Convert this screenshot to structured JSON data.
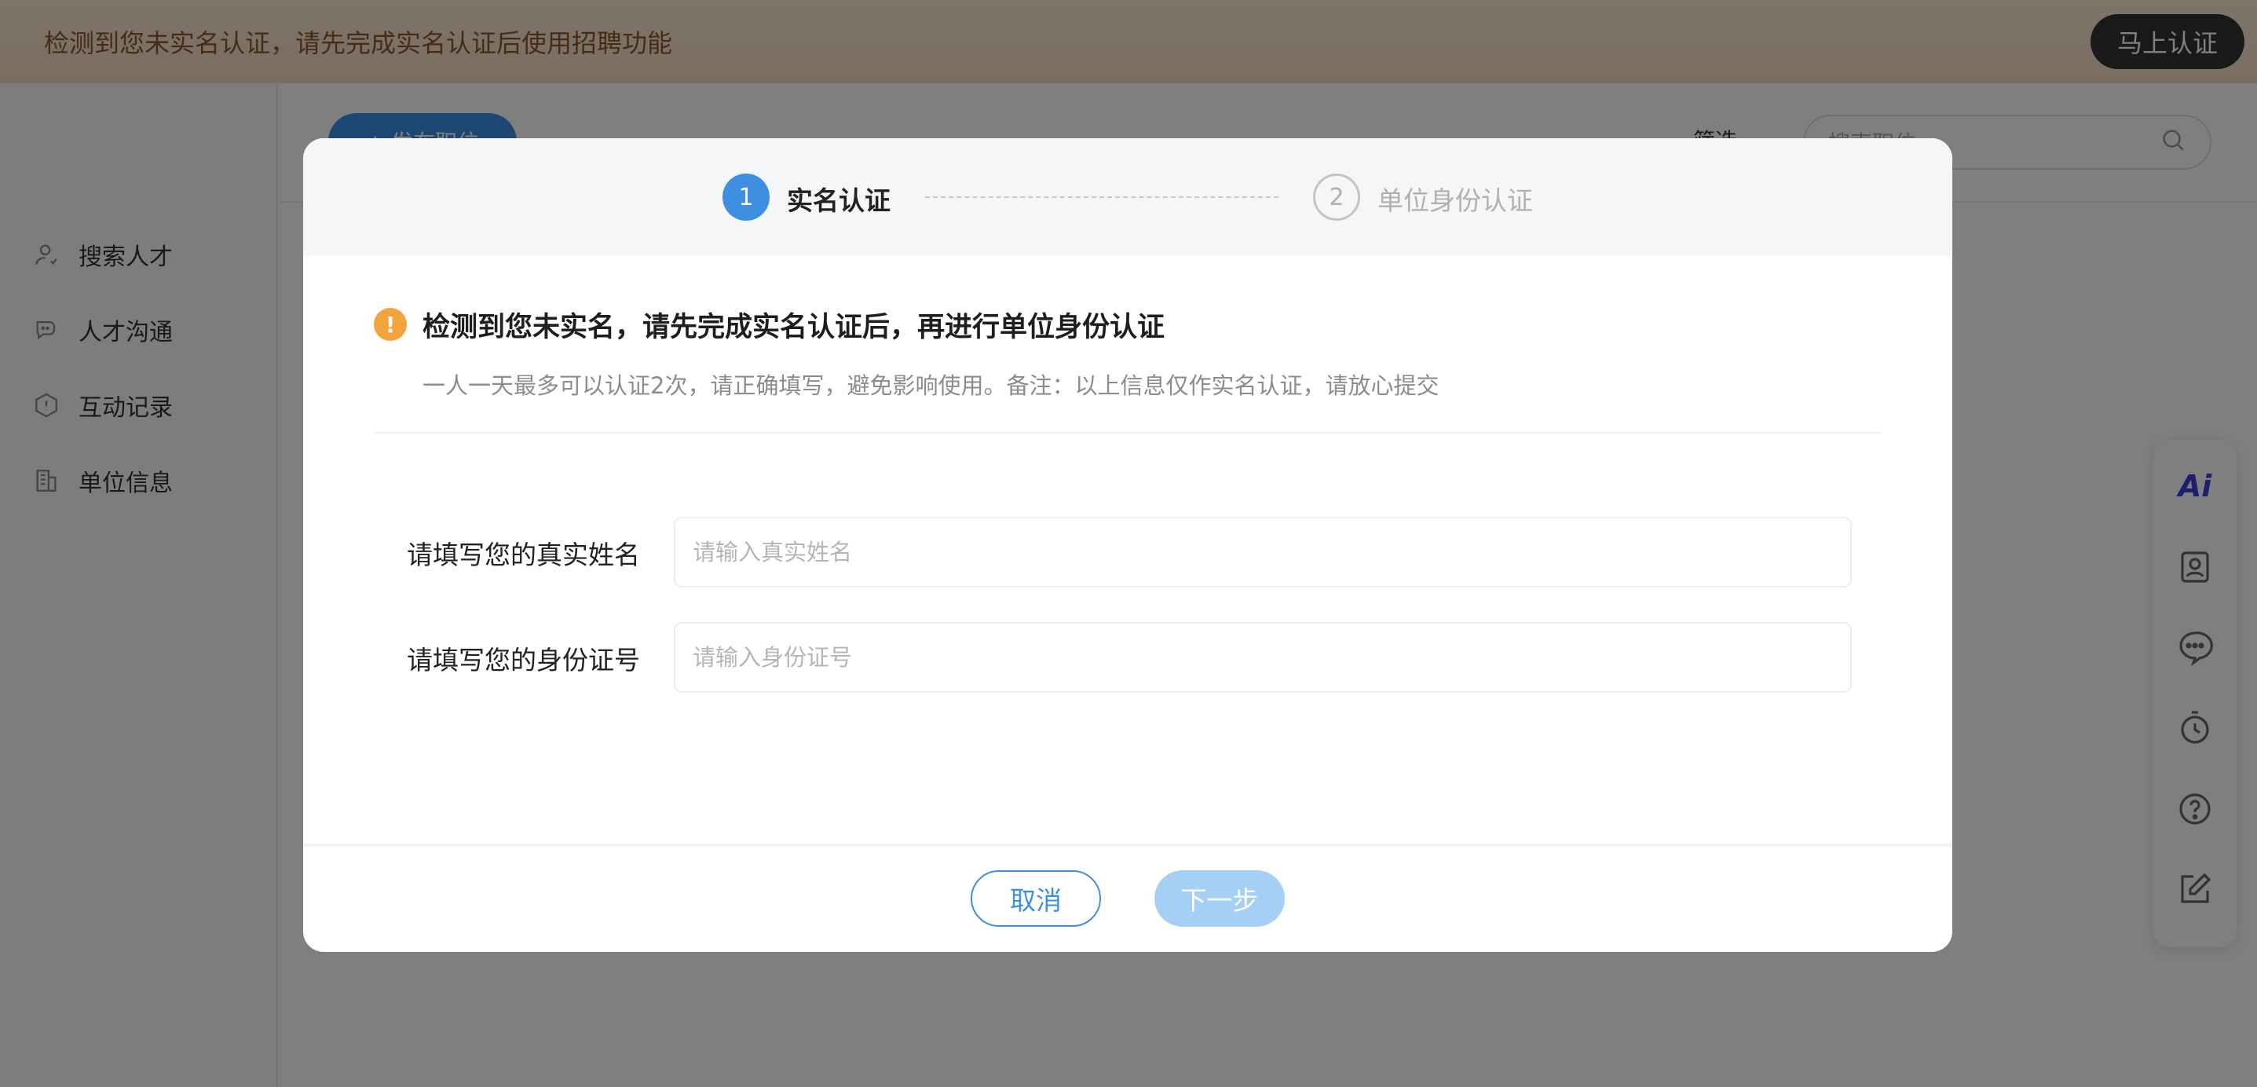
{
  "banner": {
    "text": "检测到您未实名认证，请先完成实名认证后使用招聘功能",
    "action_label": "马上认证"
  },
  "sidebar": {
    "items": [
      {
        "label": "搜索人才",
        "icon": "user-icon"
      },
      {
        "label": "人才沟通",
        "icon": "chat-icon"
      },
      {
        "label": "互动记录",
        "icon": "hexagon-icon"
      },
      {
        "label": "单位信息",
        "icon": "building-icon"
      }
    ]
  },
  "topbar": {
    "publish_label": "+ 发布职位",
    "filter_label": "筛选",
    "search_placeholder": "搜索职位"
  },
  "floatbar": {
    "ai_label": "Ai",
    "icons": [
      "ai-icon",
      "resume-icon",
      "message-icon",
      "timer-icon",
      "help-icon",
      "edit-icon"
    ]
  },
  "modal": {
    "steps": [
      {
        "number": "1",
        "label": "实名认证",
        "active": true
      },
      {
        "number": "2",
        "label": "单位身份认证",
        "active": false
      }
    ],
    "notice": {
      "title": "检测到您未实名，请先完成实名认证后，再进行单位身份认证",
      "description": "一人一天最多可以认证2次，请正确填写，避免影响使用。备注：以上信息仅作实名认证，请放心提交"
    },
    "form": {
      "name_label": "请填写您的真实姓名",
      "name_placeholder": "请输入真实姓名",
      "name_value": "",
      "id_label": "请填写您的身份证号",
      "id_placeholder": "请输入身份证号",
      "id_value": ""
    },
    "footer": {
      "cancel_label": "取消",
      "next_label": "下一步"
    },
    "colors": {
      "primary": "#3f8fe0",
      "disabled_primary": "#a6cff5",
      "warning": "#f3a33a"
    }
  }
}
